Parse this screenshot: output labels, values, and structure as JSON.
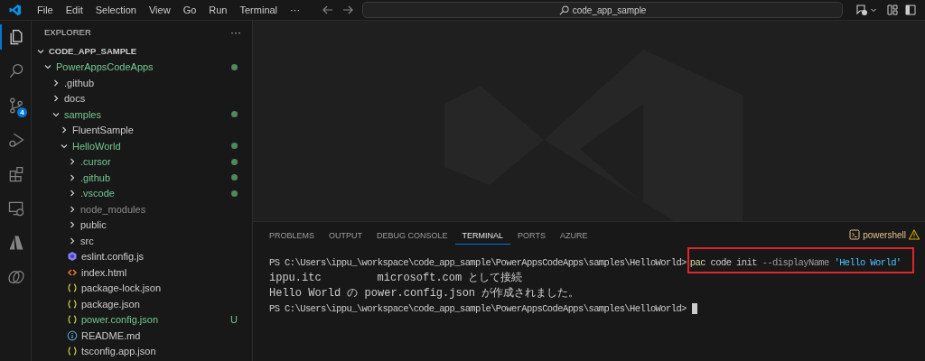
{
  "menu": [
    "File",
    "Edit",
    "Selection",
    "View",
    "Go",
    "Run",
    "Terminal",
    "···"
  ],
  "search": {
    "value": "code_app_sample"
  },
  "activity_bar": [
    {
      "kind": "explorer",
      "selected": true
    },
    {
      "kind": "search",
      "selected": false
    },
    {
      "kind": "source-control",
      "selected": false,
      "badge": "4"
    },
    {
      "kind": "run-debug",
      "selected": false
    },
    {
      "kind": "extensions",
      "selected": false
    },
    {
      "kind": "remote",
      "selected": false
    },
    {
      "kind": "azure",
      "selected": false
    },
    {
      "kind": "rings",
      "selected": false
    }
  ],
  "sidebar": {
    "title": "EXPLORER",
    "more": "···",
    "section": {
      "label": "CODE_APP_SAMPLE",
      "expanded": true
    },
    "tree": [
      {
        "label": "PowerAppsCodeApps",
        "kind": "folder",
        "expanded": true,
        "changed": true,
        "ignored": false,
        "children": [
          {
            "label": ".github",
            "kind": "folder",
            "expanded": false,
            "changed": false,
            "ignored": false
          },
          {
            "label": "docs",
            "kind": "folder",
            "expanded": false,
            "changed": false,
            "ignored": false
          },
          {
            "label": "samples",
            "kind": "folder",
            "expanded": true,
            "changed": true,
            "ignored": false,
            "children": [
              {
                "label": "FluentSample",
                "kind": "folder",
                "expanded": false,
                "changed": false,
                "ignored": false
              },
              {
                "label": "HelloWorld",
                "kind": "folder",
                "expanded": true,
                "changed": true,
                "ignored": false,
                "children": [
                  {
                    "label": ".cursor",
                    "kind": "folder",
                    "expanded": false,
                    "changed": true,
                    "ignored": false
                  },
                  {
                    "label": ".github",
                    "kind": "folder",
                    "expanded": false,
                    "changed": true,
                    "ignored": false
                  },
                  {
                    "label": ".vscode",
                    "kind": "folder",
                    "expanded": false,
                    "changed": true,
                    "ignored": false
                  },
                  {
                    "label": "node_modules",
                    "kind": "folder",
                    "expanded": false,
                    "changed": false,
                    "ignored": true
                  },
                  {
                    "label": "public",
                    "kind": "folder",
                    "expanded": false,
                    "changed": false,
                    "ignored": false
                  },
                  {
                    "label": "src",
                    "kind": "folder",
                    "expanded": false,
                    "changed": false,
                    "ignored": false
                  },
                  {
                    "label": "eslint.config.js",
                    "kind": "eslint",
                    "changed": false,
                    "ignored": false
                  },
                  {
                    "label": "index.html",
                    "kind": "html",
                    "changed": false,
                    "ignored": false
                  },
                  {
                    "label": "package-lock.json",
                    "kind": "json",
                    "changed": false,
                    "ignored": false
                  },
                  {
                    "label": "package.json",
                    "kind": "json",
                    "changed": false,
                    "ignored": false
                  },
                  {
                    "label": "power.config.json",
                    "kind": "json",
                    "changed": true,
                    "ignored": false,
                    "badge": "U"
                  },
                  {
                    "label": "README.md",
                    "kind": "info",
                    "changed": false,
                    "ignored": false
                  },
                  {
                    "label": "tsconfig.app.json",
                    "kind": "json",
                    "changed": false,
                    "ignored": false
                  }
                ]
              }
            ]
          }
        ]
      }
    ]
  },
  "panel": {
    "tabs": [
      {
        "label": "PROBLEMS",
        "selected": false
      },
      {
        "label": "OUTPUT",
        "selected": false
      },
      {
        "label": "DEBUG CONSOLE",
        "selected": false
      },
      {
        "label": "TERMINAL",
        "selected": true
      },
      {
        "label": "PORTS",
        "selected": false
      },
      {
        "label": "AZURE",
        "selected": false
      }
    ],
    "shell": "powershell",
    "terminal": [
      {
        "kind": "command",
        "prompt": "PS C:\\Users\\ippu_\\workspace\\code_app_sample\\PowerAppsCodeApps\\samples\\HelloWorld>",
        "highlighted": true,
        "tokens": [
          {
            "kind": "program",
            "text": "pac"
          },
          {
            "kind": "plain",
            "text": "code init"
          },
          {
            "kind": "option",
            "text": "--displayName"
          },
          {
            "kind": "string",
            "text": "'Hello World'"
          }
        ]
      },
      {
        "kind": "split",
        "parts": [
          "ippu.itc",
          "microsoft.com として接続"
        ]
      },
      {
        "kind": "output",
        "text": "Hello World の power.config.json が作成されました。"
      },
      {
        "kind": "prompt",
        "prompt": "PS C:\\Users\\ippu_\\workspace\\code_app_sample\\PowerAppsCodeApps\\samples\\HelloWorld>",
        "cursor": true
      }
    ]
  }
}
